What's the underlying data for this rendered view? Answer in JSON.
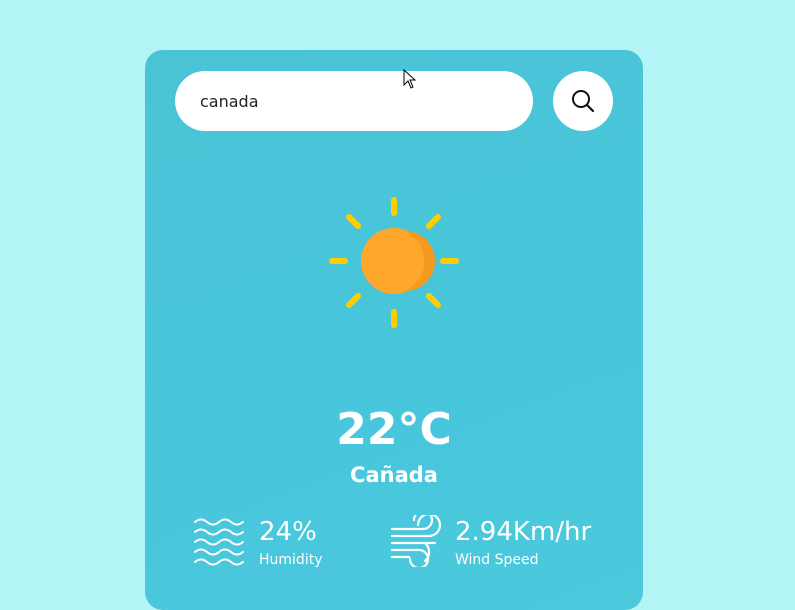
{
  "search": {
    "value": "canada",
    "icon": "search-icon"
  },
  "weather": {
    "icon": "sun-icon",
    "temperature": "22°C",
    "city": "Cañada"
  },
  "details": {
    "humidity": {
      "icon": "waves-icon",
      "value": "24%",
      "label": "Humidity"
    },
    "wind": {
      "icon": "wind-icon",
      "value": "2.94Km/hr",
      "label": "Wind Speed"
    }
  },
  "colors": {
    "page_background": "#b3f5f6",
    "card_background": "#48c6db",
    "sun_core": "#ffa72a",
    "sun_rays": "#ffce00"
  }
}
